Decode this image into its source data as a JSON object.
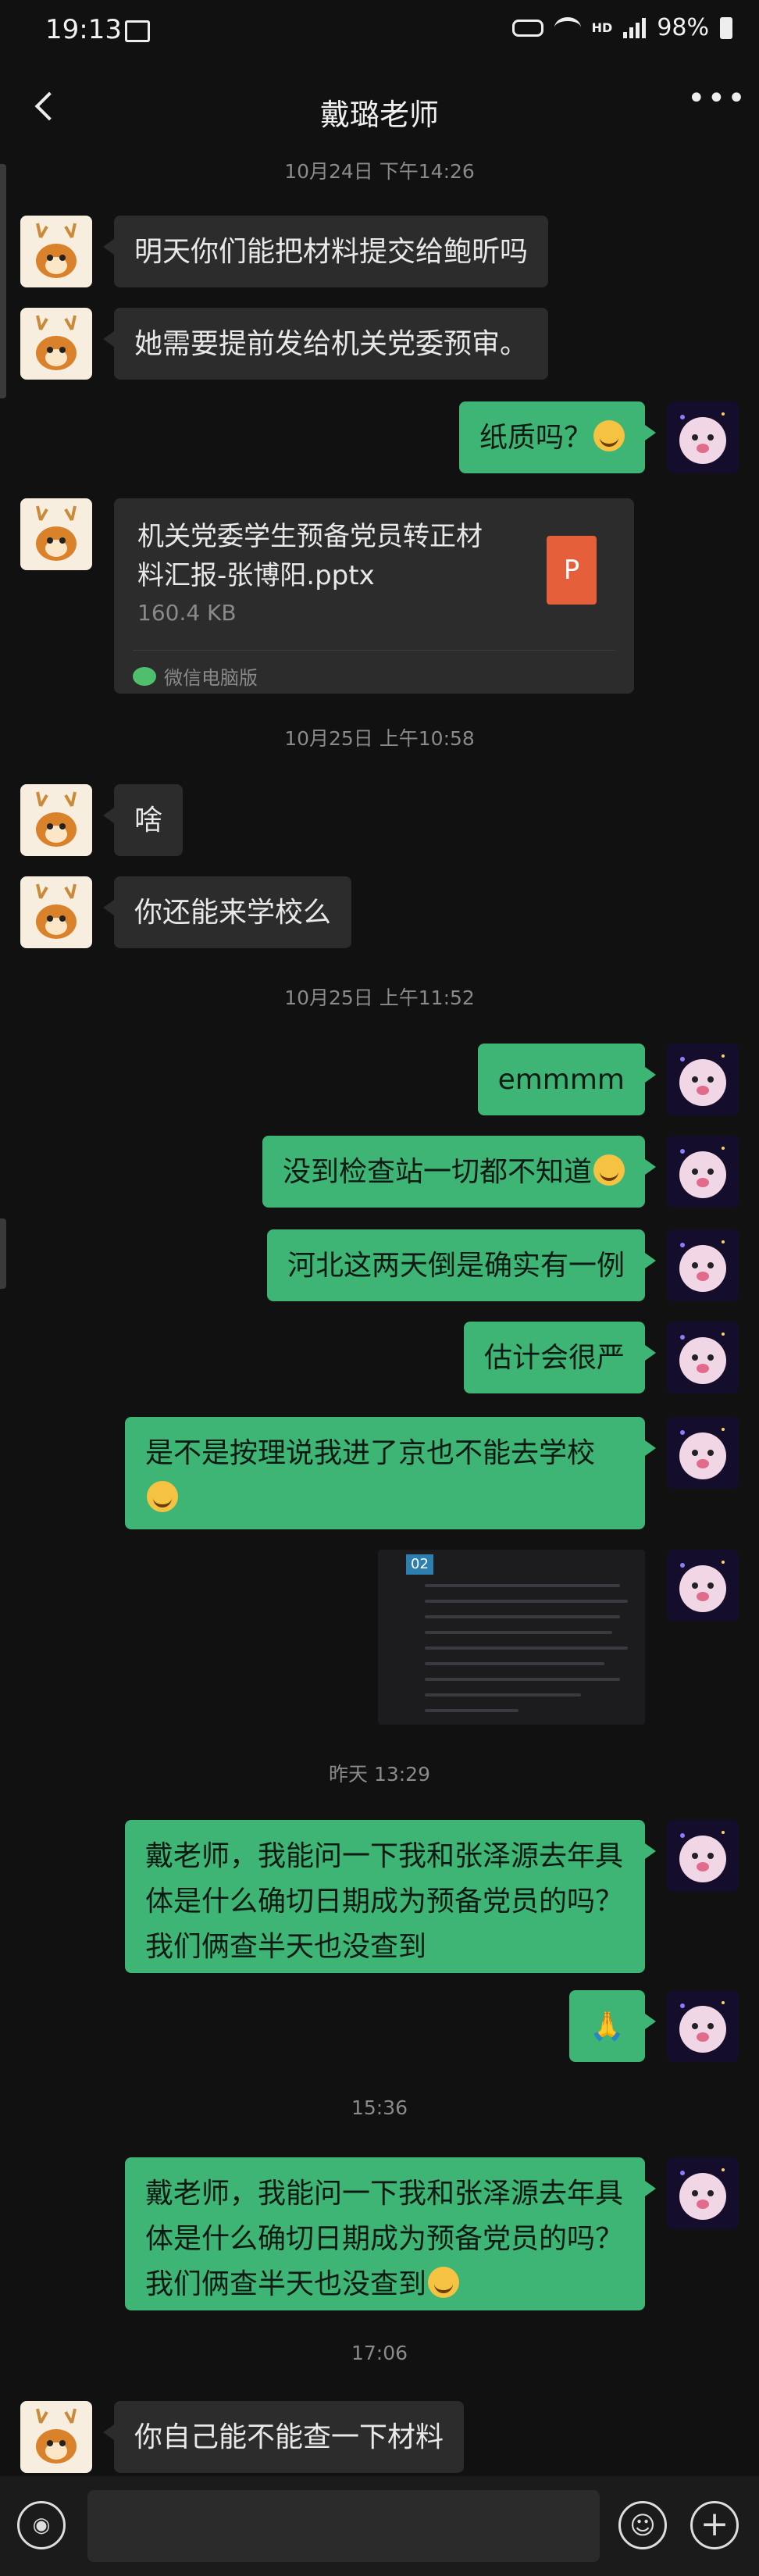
{
  "status_bar": {
    "time": "19:13",
    "network": "HD",
    "battery": "98%"
  },
  "nav": {
    "title": "戴璐老师"
  },
  "timestamps": {
    "t1": "10月24日 下午14:26",
    "t2": "10月25日 上午10:58",
    "t3": "10月25日 上午11:52",
    "t4": "昨天 13:29",
    "t5": "15:36",
    "t6": "17:06"
  },
  "messages": {
    "m1": "明天你们能把材料提交给鲍昕吗",
    "m2": "她需要提前发给机关党委预审。",
    "m3": "纸质吗？",
    "file": {
      "name": "机关党委学生预备党员转正材料汇报-张博阳.pptx",
      "size": "160.4 KB",
      "source": "微信电脑版",
      "icon": "P"
    },
    "m4": "啥",
    "m5": "你还能来学校么",
    "m6": "emmmm",
    "m7": "没到检查站一切都不知道",
    "m8": "河北这两天倒是确实有一例",
    "m9": "估计会很严",
    "m10": "是不是按理说我进了京也不能去学校",
    "img_badge": "02",
    "m11": "戴老师，我能问一下我和张泽源去年具体是什么确切日期成为预备党员的吗？我们俩查半天也没查到",
    "m12": "🙏",
    "m13": "戴老师，我能问一下我和张泽源去年具体是什么确切日期成为预备党员的吗？我们俩查半天也没查到",
    "m14": "你自己能不能查一下材料"
  },
  "input": {
    "value": ""
  },
  "icons": {
    "back": "back-arrow-icon",
    "more": "more-dots-icon",
    "voice": "voice-icon",
    "emoji": "emoji-icon",
    "plus": "plus-icon",
    "laugh": "laugh-cry-emoji"
  }
}
